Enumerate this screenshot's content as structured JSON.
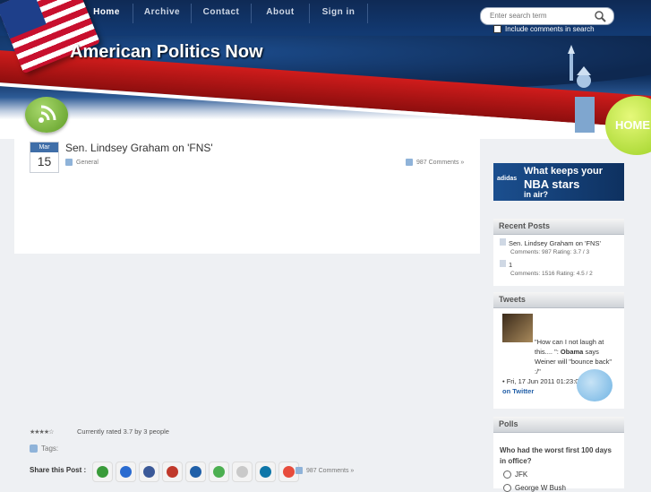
{
  "nav": {
    "items": [
      {
        "label": "Home",
        "active": true
      },
      {
        "label": "Archive"
      },
      {
        "label": "Contact"
      },
      {
        "label": "About"
      },
      {
        "label": "Sign in"
      }
    ]
  },
  "site": {
    "title": "American Politics Now"
  },
  "search": {
    "placeholder": "Enter search term",
    "include_label": "Include comments in search"
  },
  "home_badge": "HOME",
  "post": {
    "date_month": "Mar",
    "date_day": "15",
    "title": "Sen. Lindsey Graham on 'FNS'",
    "category": "General",
    "comments": "987 Comments »",
    "rating_text": "Currently rated 3.7 by 3 people",
    "rating_value": 3.7,
    "rating_max": 5,
    "tags_label": "Tags:",
    "share_label": "Share this Post :",
    "share_icons": [
      "email-icon",
      "delicious-icon",
      "facebook-icon",
      "myspace-icon",
      "windows-live-icon",
      "stumbleupon-icon",
      "digg-icon",
      "linkedin-icon",
      "rss-icon"
    ],
    "share_comments": "987 Comments »"
  },
  "ad": {
    "brand": "adidas",
    "line1": "What keeps your",
    "line2": "NBA stars",
    "line3": "in air?"
  },
  "recent_posts": {
    "heading": "Recent Posts",
    "items": [
      {
        "title": "Sen. Lindsey Graham on 'FNS'",
        "meta": "Comments: 987  Rating: 3.7 / 3"
      },
      {
        "title": "1",
        "meta": "Comments: 1516  Rating: 4.5 / 2"
      }
    ]
  },
  "tweets": {
    "heading": "Tweets",
    "text_pre": "\"How can I not laugh at this.... \": ",
    "highlight": "Obama",
    "text_post": " says Weiner will \"bounce back\" :/\"",
    "meta": "• Fri, 17 Jun 2011 01:23:07 • ",
    "link": "Read it on Twitter"
  },
  "polls": {
    "heading": "Polls",
    "question": "Who had the worst first 100 days in office?",
    "options": [
      "JFK",
      "George W Bush"
    ]
  },
  "colors": {
    "accent_blue": "#0f2a55",
    "accent_red": "#c8102e",
    "link": "#2360a8"
  }
}
